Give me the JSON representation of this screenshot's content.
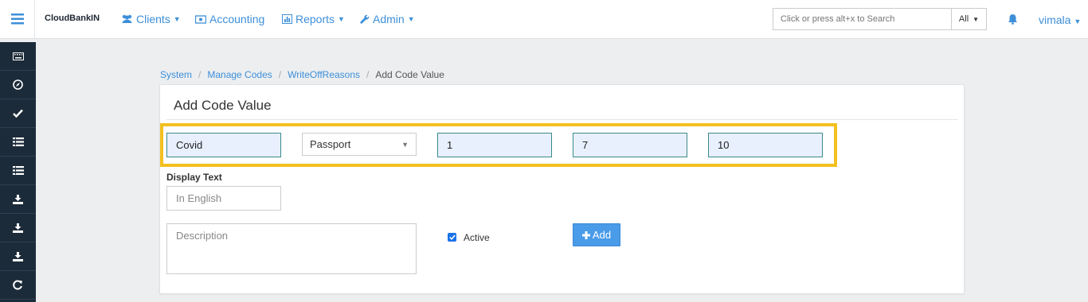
{
  "navbar": {
    "brand": "CloudBankIN",
    "menu": [
      {
        "label": "Clients",
        "icon": "users-icon",
        "has_caret": true
      },
      {
        "label": "Accounting",
        "icon": "money-icon",
        "has_caret": false
      },
      {
        "label": "Reports",
        "icon": "bar-chart-icon",
        "has_caret": true
      },
      {
        "label": "Admin",
        "icon": "wrench-icon",
        "has_caret": true
      }
    ],
    "search": {
      "placeholder": "Click or press alt+x to Search",
      "scope": "All"
    },
    "user": "vimala"
  },
  "sidebar": {
    "icons": [
      "keyboard-icon",
      "compass-icon",
      "check-icon",
      "list-icon",
      "list-icon",
      "download-icon",
      "download-icon",
      "download-icon",
      "refresh-icon"
    ]
  },
  "breadcrumb": {
    "items": [
      "System",
      "Manage Codes",
      "WriteOffReasons"
    ],
    "current": "Add Code Value"
  },
  "form": {
    "title": "Add Code Value",
    "name_value": "Covid",
    "type_selected": "Passport",
    "position_value": "1",
    "score_value": "7",
    "limit_value": "10",
    "display_text_label": "Display Text",
    "display_text_placeholder": "In English",
    "description_placeholder": "Description",
    "active_label": "Active",
    "active_checked": true,
    "add_label": "Add"
  },
  "colors": {
    "accent": "#3d8fd9",
    "highlight": "#f4c020",
    "sidebar_bg": "#1c2b39",
    "button": "#4a9be8"
  }
}
